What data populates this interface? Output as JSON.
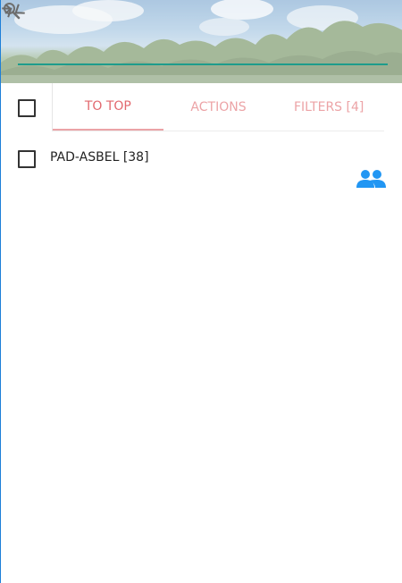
{
  "search": {
    "value": "",
    "placeholder": ""
  },
  "toolbar": {
    "tabs": [
      {
        "label": "TO TOP",
        "active": true
      },
      {
        "label": "ACTIONS",
        "active": false
      },
      {
        "label": "FILTERS [4]",
        "active": false
      }
    ]
  },
  "list": {
    "items": [
      {
        "label": "PAD-ASBEL [38]",
        "icon": "group-icon"
      }
    ]
  },
  "colors": {
    "accent_tab_active": "#e2686e",
    "accent_tab": "#eca3a6",
    "search_underline": "#1e9c8c",
    "group_icon": "#2196f3",
    "panel_border": "#1e7fd8"
  },
  "icons": {
    "search": "search-icon",
    "expand": "chevron-right-icon",
    "collapse": "collapse-arrows-icon",
    "group": "group-icon"
  }
}
